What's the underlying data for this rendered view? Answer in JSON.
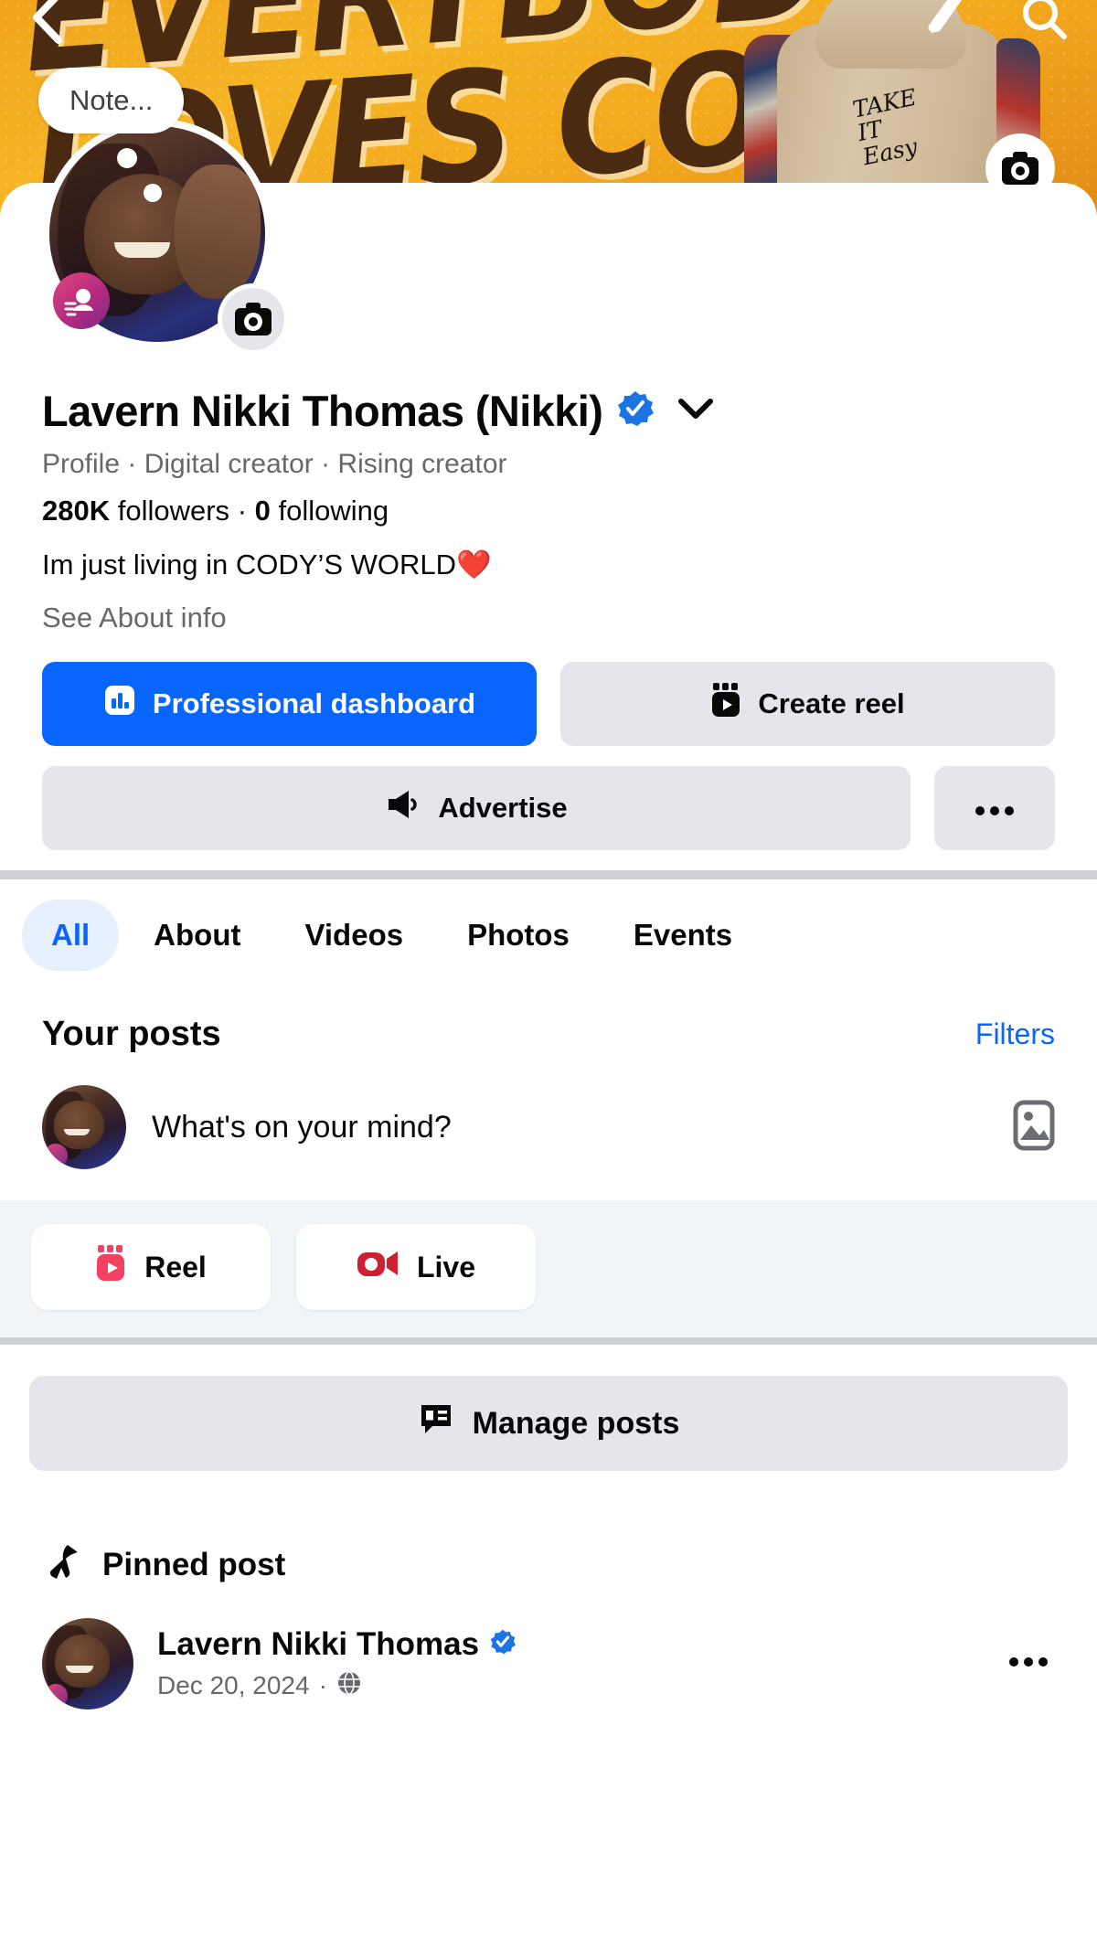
{
  "cover": {
    "headline_line1": "EVERYBODY",
    "headline_line2": "LOVES CODY",
    "hoodie_script": "TAKE\nIT\nEasy",
    "camera_icon": "camera-icon",
    "back_icon": "back-chevron-icon",
    "edit_icon": "edit-pencil-icon",
    "search_icon": "search-icon"
  },
  "note": {
    "text": "Note..."
  },
  "profile": {
    "name": "Lavern Nikki Thomas (Nikki)",
    "verified": true,
    "subtitle": "Profile · Digital creator · Rising creator",
    "followers_count": "280K",
    "followers_label": "followers",
    "separator": "·",
    "following_count": "0",
    "following_label": "following",
    "bio": "Im just living in CODY’S WORLD❤️",
    "see_about": "See About info",
    "avatar_camera_icon": "camera-icon",
    "creator_badge_icon": "rising-creator-icon",
    "name_chevron_icon": "chevron-down-icon"
  },
  "actions": {
    "professional_dashboard": "Professional dashboard",
    "create_reel": "Create reel",
    "advertise": "Advertise",
    "more": "···",
    "dashboard_icon": "bar-chart-icon",
    "reel_icon": "reel-icon",
    "advertise_icon": "megaphone-icon",
    "more_icon": "ellipsis-icon",
    "primary_color": "#0866ff",
    "secondary_color": "#e4e6eb"
  },
  "tabs": [
    {
      "label": "All",
      "active": true
    },
    {
      "label": "About",
      "active": false
    },
    {
      "label": "Videos",
      "active": false
    },
    {
      "label": "Photos",
      "active": false
    },
    {
      "label": "Events",
      "active": false
    }
  ],
  "posts_section": {
    "title": "Your posts",
    "filters": "Filters",
    "filters_color": "#0a66ff"
  },
  "composer": {
    "placeholder": "What's on your mind?",
    "photo_icon": "photo-icon"
  },
  "quick_actions": [
    {
      "label": "Reel",
      "icon": "reel-icon",
      "color": "#f3425f"
    },
    {
      "label": "Live",
      "icon": "live-video-icon",
      "color": "#cf2032"
    }
  ],
  "manage": {
    "label": "Manage posts",
    "icon": "manage-posts-icon"
  },
  "pinned": {
    "label": "Pinned post",
    "icon": "pin-icon"
  },
  "post": {
    "author": "Lavern Nikki Thomas",
    "verified": true,
    "date": "Dec 20, 2024",
    "separator": "·",
    "privacy_icon": "globe-icon",
    "menu_icon": "ellipsis-icon"
  }
}
